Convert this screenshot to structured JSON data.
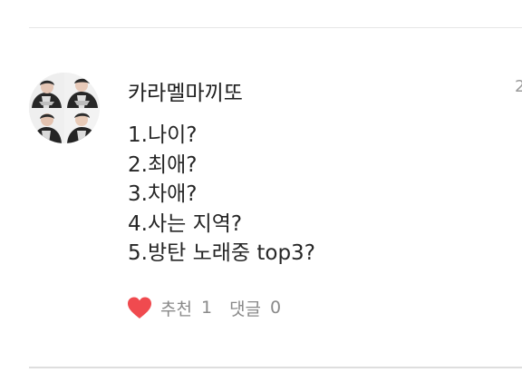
{
  "comment": {
    "username": "카라멜마끼또",
    "timestamp": "2",
    "lines": [
      "1.나이?",
      "2.최애?",
      "3.차애?",
      "4.사는 지역?",
      "5.방탄 노래중 top3?"
    ],
    "actions": {
      "like_label": "추천",
      "like_count": "1",
      "reply_label": "댓글",
      "reply_count": "0"
    },
    "avatar": {
      "icon": "profile-collage-avatar"
    }
  },
  "colors": {
    "heart": "#f04a4f",
    "text_primary": "#222222",
    "text_secondary": "#8a8a8a",
    "divider": "#e6e6e6"
  }
}
